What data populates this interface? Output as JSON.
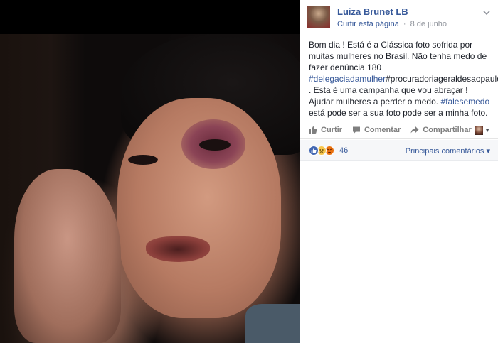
{
  "post": {
    "page_name": "Luiza Brunet LB",
    "like_page": "Curtir esta página",
    "separator": "·",
    "date": "8 de junho",
    "options_icon": "chevron-down-icon",
    "text_segments": [
      {
        "text": "Bom dia ! Está é a Clássica foto sofrida por muitas mulheres no Brasil. Não tenha medo de fazer denúncia 180 ",
        "type": "text"
      },
      {
        "text": "#delegaciadamulher",
        "type": "tag"
      },
      {
        "text": "#procuradoriageraldesaopaulo",
        "type": "text"
      },
      {
        "text": " . Esta é uma campanha que vou abraçar ! Ajudar mulheres a perder o medo. ",
        "type": "text"
      },
      {
        "text": "#falesemedo",
        "type": "tag"
      },
      {
        "text": " está pode ser a sua foto pode ser a minha foto.",
        "type": "text"
      }
    ]
  },
  "actions": {
    "like": "Curtir",
    "comment": "Comentar",
    "share": "Compartilhar",
    "like_icon": "thumbs-up-icon",
    "comment_icon": "speech-bubble-icon",
    "share_icon": "share-arrow-icon"
  },
  "reactions": {
    "count": "46",
    "icons": [
      "like-reaction-icon",
      "sad-reaction-icon",
      "angry-reaction-icon"
    ],
    "top_comments": "Principais comentários",
    "top_comments_caret": "▾"
  },
  "colors": {
    "link": "#365899",
    "text": "#1d2129",
    "meta": "#90949c",
    "like": "#4267b2",
    "sad": "#f7c64c",
    "angry": "#e9710f"
  }
}
